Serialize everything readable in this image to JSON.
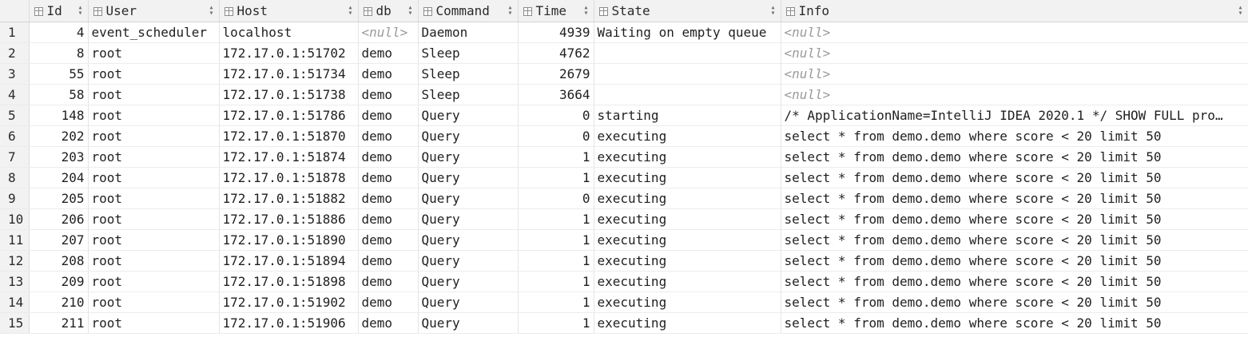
{
  "columns": [
    "Id",
    "User",
    "Host",
    "db",
    "Command",
    "Time",
    "State",
    "Info"
  ],
  "null_text": "<null>",
  "rows": [
    {
      "n": "1",
      "id": "4",
      "user": "event_scheduler",
      "host": "localhost",
      "db": null,
      "command": "Daemon",
      "time": "4939",
      "state": "Waiting on empty queue",
      "info": null
    },
    {
      "n": "2",
      "id": "8",
      "user": "root",
      "host": "172.17.0.1:51702",
      "db": "demo",
      "command": "Sleep",
      "time": "4762",
      "state": "",
      "info": null
    },
    {
      "n": "3",
      "id": "55",
      "user": "root",
      "host": "172.17.0.1:51734",
      "db": "demo",
      "command": "Sleep",
      "time": "2679",
      "state": "",
      "info": null
    },
    {
      "n": "4",
      "id": "58",
      "user": "root",
      "host": "172.17.0.1:51738",
      "db": "demo",
      "command": "Sleep",
      "time": "3664",
      "state": "",
      "info": null
    },
    {
      "n": "5",
      "id": "148",
      "user": "root",
      "host": "172.17.0.1:51786",
      "db": "demo",
      "command": "Query",
      "time": "0",
      "state": "starting",
      "info": "/* ApplicationName=IntelliJ IDEA 2020.1 */ SHOW FULL pro…"
    },
    {
      "n": "6",
      "id": "202",
      "user": "root",
      "host": "172.17.0.1:51870",
      "db": "demo",
      "command": "Query",
      "time": "0",
      "state": "executing",
      "info": "select * from demo.demo where score < 20 limit 50"
    },
    {
      "n": "7",
      "id": "203",
      "user": "root",
      "host": "172.17.0.1:51874",
      "db": "demo",
      "command": "Query",
      "time": "1",
      "state": "executing",
      "info": "select * from demo.demo where score < 20 limit 50"
    },
    {
      "n": "8",
      "id": "204",
      "user": "root",
      "host": "172.17.0.1:51878",
      "db": "demo",
      "command": "Query",
      "time": "1",
      "state": "executing",
      "info": "select * from demo.demo where score < 20 limit 50"
    },
    {
      "n": "9",
      "id": "205",
      "user": "root",
      "host": "172.17.0.1:51882",
      "db": "demo",
      "command": "Query",
      "time": "0",
      "state": "executing",
      "info": "select * from demo.demo where score < 20 limit 50"
    },
    {
      "n": "10",
      "id": "206",
      "user": "root",
      "host": "172.17.0.1:51886",
      "db": "demo",
      "command": "Query",
      "time": "1",
      "state": "executing",
      "info": "select * from demo.demo where score < 20 limit 50"
    },
    {
      "n": "11",
      "id": "207",
      "user": "root",
      "host": "172.17.0.1:51890",
      "db": "demo",
      "command": "Query",
      "time": "1",
      "state": "executing",
      "info": "select * from demo.demo where score < 20 limit 50"
    },
    {
      "n": "12",
      "id": "208",
      "user": "root",
      "host": "172.17.0.1:51894",
      "db": "demo",
      "command": "Query",
      "time": "1",
      "state": "executing",
      "info": "select * from demo.demo where score < 20 limit 50"
    },
    {
      "n": "13",
      "id": "209",
      "user": "root",
      "host": "172.17.0.1:51898",
      "db": "demo",
      "command": "Query",
      "time": "1",
      "state": "executing",
      "info": "select * from demo.demo where score < 20 limit 50"
    },
    {
      "n": "14",
      "id": "210",
      "user": "root",
      "host": "172.17.0.1:51902",
      "db": "demo",
      "command": "Query",
      "time": "1",
      "state": "executing",
      "info": "select * from demo.demo where score < 20 limit 50"
    },
    {
      "n": "15",
      "id": "211",
      "user": "root",
      "host": "172.17.0.1:51906",
      "db": "demo",
      "command": "Query",
      "time": "1",
      "state": "executing",
      "info": "select * from demo.demo where score < 20 limit 50"
    }
  ]
}
